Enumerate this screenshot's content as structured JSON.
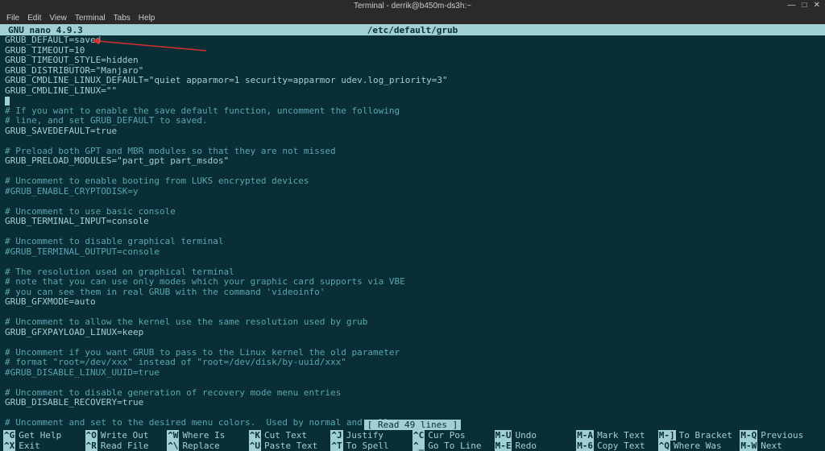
{
  "window": {
    "title": "Terminal - derrik@b450m-ds3h:~"
  },
  "menu": {
    "items": [
      "File",
      "Edit",
      "View",
      "Terminal",
      "Tabs",
      "Help"
    ]
  },
  "nano": {
    "version": "GNU nano 4.9.3",
    "filename": "/etc/default/grub",
    "status": "[ Read 49 lines ]"
  },
  "content": {
    "lines": [
      "GRUB_DEFAULT=saved",
      "GRUB_TIMEOUT=10",
      "GRUB_TIMEOUT_STYLE=hidden",
      "GRUB_DISTRIBUTOR=\"Manjaro\"",
      "GRUB_CMDLINE_LINUX_DEFAULT=\"quiet apparmor=1 security=apparmor udev.log_priority=3\"",
      "GRUB_CMDLINE_LINUX=\"\"",
      "",
      "# If you want to enable the save default function, uncomment the following",
      "# line, and set GRUB_DEFAULT to saved.",
      "GRUB_SAVEDEFAULT=true",
      "",
      "# Preload both GPT and MBR modules so that they are not missed",
      "GRUB_PRELOAD_MODULES=\"part_gpt part_msdos\"",
      "",
      "# Uncomment to enable booting from LUKS encrypted devices",
      "#GRUB_ENABLE_CRYPTODISK=y",
      "",
      "# Uncomment to use basic console",
      "GRUB_TERMINAL_INPUT=console",
      "",
      "# Uncomment to disable graphical terminal",
      "#GRUB_TERMINAL_OUTPUT=console",
      "",
      "# The resolution used on graphical terminal",
      "# note that you can use only modes which your graphic card supports via VBE",
      "# you can see them in real GRUB with the command 'videoinfo'",
      "GRUB_GFXMODE=auto",
      "",
      "# Uncomment to allow the kernel use the same resolution used by grub",
      "GRUB_GFXPAYLOAD_LINUX=keep",
      "",
      "# Uncomment if you want GRUB to pass to the Linux kernel the old parameter",
      "# format \"root=/dev/xxx\" instead of \"root=/dev/disk/by-uuid/xxx\"",
      "#GRUB_DISABLE_LINUX_UUID=true",
      "",
      "# Uncomment to disable generation of recovery mode menu entries",
      "GRUB_DISABLE_RECOVERY=true",
      "",
      "# Uncomment and set to the desired menu colors.  Used by normal and wallpaper"
    ]
  },
  "shortcuts": {
    "row1": [
      {
        "key": "^G",
        "label": "Get Help"
      },
      {
        "key": "^O",
        "label": "Write Out"
      },
      {
        "key": "^W",
        "label": "Where Is"
      },
      {
        "key": "^K",
        "label": "Cut Text"
      },
      {
        "key": "^J",
        "label": "Justify"
      },
      {
        "key": "^C",
        "label": "Cur Pos"
      },
      {
        "key": "M-U",
        "label": "Undo"
      }
    ],
    "row1b": [
      {
        "key": "M-A",
        "label": "Mark Text"
      },
      {
        "key": "M-]",
        "label": "To Bracket"
      },
      {
        "key": "M-Q",
        "label": "Previous"
      }
    ],
    "row2": [
      {
        "key": "^X",
        "label": "Exit"
      },
      {
        "key": "^R",
        "label": "Read File"
      },
      {
        "key": "^\\",
        "label": "Replace"
      },
      {
        "key": "^U",
        "label": "Paste Text"
      },
      {
        "key": "^T",
        "label": "To Spell"
      },
      {
        "key": "^_",
        "label": "Go To Line"
      },
      {
        "key": "M-E",
        "label": "Redo"
      }
    ],
    "row2b": [
      {
        "key": "M-6",
        "label": "Copy Text"
      },
      {
        "key": "^Q",
        "label": "Where Was"
      },
      {
        "key": "M-W",
        "label": "Next"
      }
    ]
  }
}
